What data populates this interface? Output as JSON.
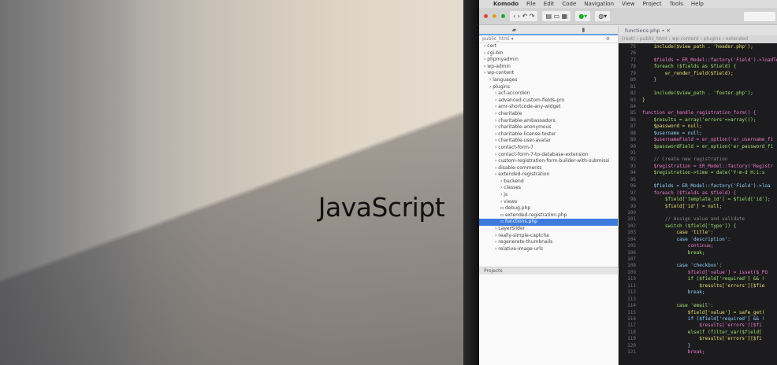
{
  "caption": "JavaScript",
  "ide": {
    "menu": [
      "Komodo",
      "File",
      "Edit",
      "Code",
      "Navigation",
      "View",
      "Project",
      "Tools",
      "Help"
    ],
    "tab": "functions.php",
    "panel_title": "public_html ▾",
    "breadcrumb": "(root) › public_html › wp-content › plugins › extended",
    "projects_label": "Projects",
    "tree": [
      {
        "t": "cert",
        "d": 0
      },
      {
        "t": "cgi-bin",
        "d": 0
      },
      {
        "t": "phpmyadmin",
        "d": 0
      },
      {
        "t": "wp-admin",
        "d": 0
      },
      {
        "t": "wp-content",
        "d": 0
      },
      {
        "t": "languages",
        "d": 1
      },
      {
        "t": "plugins",
        "d": 1
      },
      {
        "t": "acf-accordion",
        "d": 2
      },
      {
        "t": "advanced-custom-fields-pro",
        "d": 2
      },
      {
        "t": "amr-shortcode-any-widget",
        "d": 2
      },
      {
        "t": "charitable",
        "d": 2
      },
      {
        "t": "charitable-ambassadors",
        "d": 2
      },
      {
        "t": "charitable-anonymous",
        "d": 2
      },
      {
        "t": "charitable-license-tester",
        "d": 2
      },
      {
        "t": "charitable-user-avatar",
        "d": 2
      },
      {
        "t": "contact-form-7",
        "d": 2
      },
      {
        "t": "contact-form-7-to-database-extension",
        "d": 2
      },
      {
        "t": "custom-registration-form-builder-with-submissi",
        "d": 2
      },
      {
        "t": "disable-comments",
        "d": 2
      },
      {
        "t": "extended-registration",
        "d": 2
      },
      {
        "t": "backend",
        "d": 3
      },
      {
        "t": "classes",
        "d": 3
      },
      {
        "t": "js",
        "d": 3
      },
      {
        "t": "views",
        "d": 3
      },
      {
        "t": "debug.php",
        "d": 3
      },
      {
        "t": "extended-registration.php",
        "d": 3
      },
      {
        "t": "functions.php",
        "d": 3,
        "selected": true
      },
      {
        "t": "LayerSlider",
        "d": 2
      },
      {
        "t": "really-simple-captcha",
        "d": 2
      },
      {
        "t": "regenerate-thumbnails",
        "d": 2
      },
      {
        "t": "relative-image-urls",
        "d": 2
      }
    ],
    "code": [
      [
        "75",
        "    include($view_path . 'header.php');"
      ],
      [
        "76",
        ""
      ],
      [
        "77",
        "    $fields = ER_Model::factory('Field')->loadTe"
      ],
      [
        "78",
        "    foreach ($fields as $field) {"
      ],
      [
        "79",
        "        er_render_field($field);"
      ],
      [
        "80",
        "    }"
      ],
      [
        "81",
        ""
      ],
      [
        "82",
        "    include($view_path . 'footer.php');"
      ],
      [
        "83",
        "}"
      ],
      [
        "84",
        ""
      ],
      [
        "85",
        "function er_handle_registration_form() {"
      ],
      [
        "86",
        "    $results = array('errors'=>array());"
      ],
      [
        "87",
        "    $password = null;"
      ],
      [
        "88",
        "    $username = null;"
      ],
      [
        "89",
        "    $usernameField = er_option('er_username_fi"
      ],
      [
        "90",
        "    $passwordField = er_option('er_password_fi"
      ],
      [
        "91",
        ""
      ],
      [
        "92",
        "    // Create new registration"
      ],
      [
        "93",
        "    $registration = ER_Model::factory('Registr"
      ],
      [
        "94",
        "    $registration->time = date('Y-m-d H:i:s"
      ],
      [
        "95",
        ""
      ],
      [
        "96",
        "    $fields = ER_Model::factory('Field')->loa"
      ],
      [
        "97",
        "    foreach ($fields as $field) {"
      ],
      [
        "98",
        "        $field['template_id'] = $field['id'];"
      ],
      [
        "99",
        "        $field['id'] = null;"
      ],
      [
        "100",
        ""
      ],
      [
        "101",
        "        // Assign value and validate"
      ],
      [
        "102",
        "        switch ($field['type']) {"
      ],
      [
        "103",
        "            case 'title':"
      ],
      [
        "104",
        "            case 'description':"
      ],
      [
        "105",
        "                continue;"
      ],
      [
        "106",
        "                break;"
      ],
      [
        "107",
        ""
      ],
      [
        "108",
        "            case 'checkbox':"
      ],
      [
        "109",
        "                $field['value'] = isset($_PO"
      ],
      [
        "110",
        "                if ($field['required'] && !"
      ],
      [
        "111",
        "                    $results['errors'][$fie"
      ],
      [
        "112",
        "                break;"
      ],
      [
        "113",
        ""
      ],
      [
        "114",
        "            case 'email':"
      ],
      [
        "115",
        "                $field['value'] = safe_get("
      ],
      [
        "116",
        "                if ($field['required'] && !"
      ],
      [
        "117",
        "                    $results['errors'][$fi"
      ],
      [
        "118",
        "                elseif (filter_var($field["
      ],
      [
        "119",
        "                    $results['errors'][$fi"
      ],
      [
        "120",
        "                }"
      ],
      [
        "121",
        "                break;"
      ]
    ]
  },
  "colors": {
    "selection": "#3d7bdc",
    "code_bg": "#1c1c1e",
    "caption": "#111111"
  }
}
